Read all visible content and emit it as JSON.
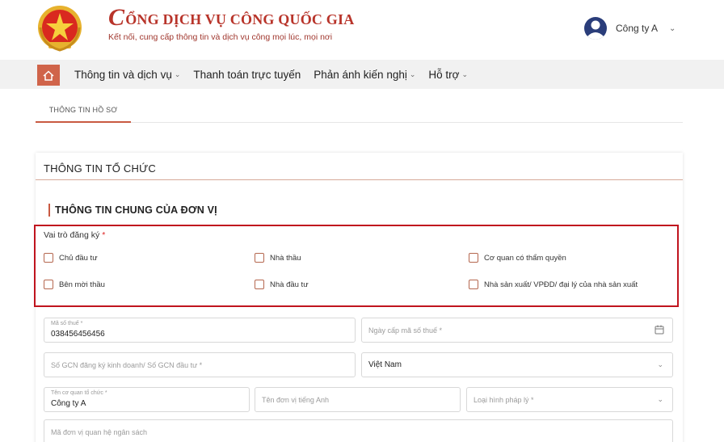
{
  "header": {
    "brand_initial": "C",
    "brand_title_rest": "ỔNG DỊCH VỤ CÔNG QUỐC GIA",
    "brand_subtitle": "Kết nối, cung cấp thông tin và dịch vụ công mọi lúc, mọi nơi",
    "user_name": "Công ty A"
  },
  "nav": {
    "items": [
      {
        "label": "Thông tin và dịch vụ",
        "has_caret": true
      },
      {
        "label": "Thanh toán trực tuyến",
        "has_caret": false
      },
      {
        "label": "Phản ánh kiến nghị",
        "has_caret": true
      },
      {
        "label": "Hỗ trợ",
        "has_caret": true
      }
    ]
  },
  "tabs": {
    "active": "THÔNG TIN HỒ SƠ"
  },
  "card": {
    "title": "THÔNG TIN TỔ CHỨC",
    "section_title": "THÔNG TIN CHUNG CỦA ĐƠN VỊ",
    "role": {
      "label": "Vai trò đăng ký",
      "required_mark": "*",
      "options": [
        "Chủ đầu tư",
        "Nhà thầu",
        "Cơ quan có thẩm quyền",
        "Bên mời thầu",
        "Nhà đầu tư",
        "Nhà sản xuất/ VPĐD/ đại lý của nhà sản xuất"
      ]
    },
    "fields": {
      "tax_code_label": "Mã số thuế *",
      "tax_code_value": "038456456456",
      "tax_date_placeholder": "Ngày cấp mã số thuế *",
      "gcn_placeholder": "Số GCN đăng ký kinh doanh/ Số GCN đầu tư *",
      "country_value": "Việt Nam",
      "org_name_label": "Tên cơ quan tổ chức *",
      "org_name_value": "Công ty A",
      "english_name_placeholder": "Tên đơn vị tiếng Anh",
      "legal_type_placeholder": "Loại hình pháp lý *",
      "budget_code_placeholder": "Mã đơn vị quan hệ ngân sách"
    }
  },
  "colors": {
    "brand_red": "#b8342a",
    "accent": "#c95a42",
    "highlight_border": "#c0141e"
  }
}
